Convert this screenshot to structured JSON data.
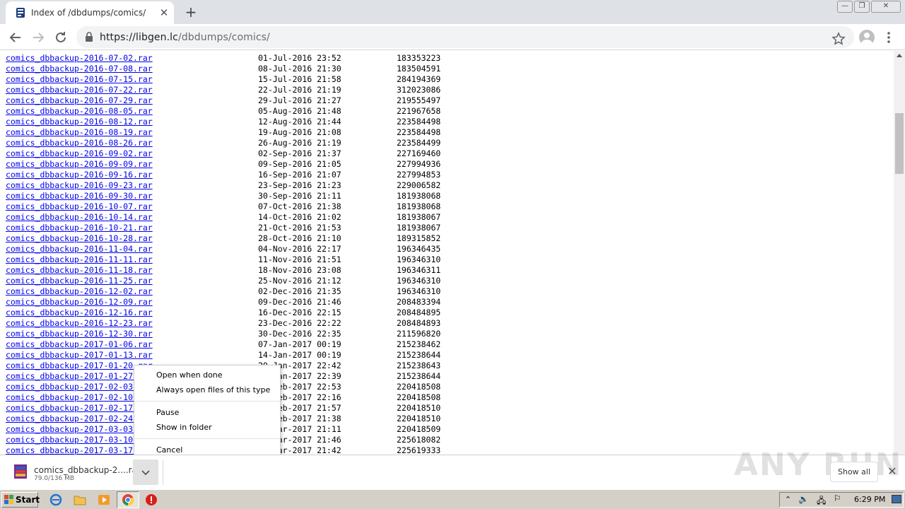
{
  "browser": {
    "tab_title": "Index of /dbdumps/comics/",
    "url_host": "https://libgen.lc",
    "url_path": "/dbdumps/comics/"
  },
  "listing": [
    {
      "name": "comics_dbbackup-2016-07-02.rar",
      "date": "01-Jul-2016 23:52",
      "size": "183353223"
    },
    {
      "name": "comics_dbbackup-2016-07-08.rar",
      "date": "08-Jul-2016 21:30",
      "size": "183504591"
    },
    {
      "name": "comics_dbbackup-2016-07-15.rar",
      "date": "15-Jul-2016 21:58",
      "size": "284194369"
    },
    {
      "name": "comics_dbbackup-2016-07-22.rar",
      "date": "22-Jul-2016 21:19",
      "size": "312023086"
    },
    {
      "name": "comics_dbbackup-2016-07-29.rar",
      "date": "29-Jul-2016 21:27",
      "size": "219555497"
    },
    {
      "name": "comics_dbbackup-2016-08-05.rar",
      "date": "05-Aug-2016 21:48",
      "size": "221967658"
    },
    {
      "name": "comics_dbbackup-2016-08-12.rar",
      "date": "12-Aug-2016 21:44",
      "size": "223584498"
    },
    {
      "name": "comics_dbbackup-2016-08-19.rar",
      "date": "19-Aug-2016 21:08",
      "size": "223584498"
    },
    {
      "name": "comics_dbbackup-2016-08-26.rar",
      "date": "26-Aug-2016 21:19",
      "size": "223584499"
    },
    {
      "name": "comics_dbbackup-2016-09-02.rar",
      "date": "02-Sep-2016 21:37",
      "size": "227169460"
    },
    {
      "name": "comics_dbbackup-2016-09-09.rar",
      "date": "09-Sep-2016 21:05",
      "size": "227994936"
    },
    {
      "name": "comics_dbbackup-2016-09-16.rar",
      "date": "16-Sep-2016 21:07",
      "size": "227994853"
    },
    {
      "name": "comics_dbbackup-2016-09-23.rar",
      "date": "23-Sep-2016 21:23",
      "size": "229006582"
    },
    {
      "name": "comics_dbbackup-2016-09-30.rar",
      "date": "30-Sep-2016 21:11",
      "size": "181938068"
    },
    {
      "name": "comics_dbbackup-2016-10-07.rar",
      "date": "07-Oct-2016 21:38",
      "size": "181938068"
    },
    {
      "name": "comics_dbbackup-2016-10-14.rar",
      "date": "14-Oct-2016 21:02",
      "size": "181938067"
    },
    {
      "name": "comics_dbbackup-2016-10-21.rar",
      "date": "21-Oct-2016 21:53",
      "size": "181938067"
    },
    {
      "name": "comics_dbbackup-2016-10-28.rar",
      "date": "28-Oct-2016 21:10",
      "size": "189315852"
    },
    {
      "name": "comics_dbbackup-2016-11-04.rar",
      "date": "04-Nov-2016 22:17",
      "size": "196346435"
    },
    {
      "name": "comics_dbbackup-2016-11-11.rar",
      "date": "11-Nov-2016 21:51",
      "size": "196346310"
    },
    {
      "name": "comics_dbbackup-2016-11-18.rar",
      "date": "18-Nov-2016 23:08",
      "size": "196346311"
    },
    {
      "name": "comics_dbbackup-2016-11-25.rar",
      "date": "25-Nov-2016 21:12",
      "size": "196346310"
    },
    {
      "name": "comics_dbbackup-2016-12-02.rar",
      "date": "02-Dec-2016 21:35",
      "size": "196346310"
    },
    {
      "name": "comics_dbbackup-2016-12-09.rar",
      "date": "09-Dec-2016 21:46",
      "size": "208483394"
    },
    {
      "name": "comics_dbbackup-2016-12-16.rar",
      "date": "16-Dec-2016 22:15",
      "size": "208484895"
    },
    {
      "name": "comics_dbbackup-2016-12-23.rar",
      "date": "23-Dec-2016 22:22",
      "size": "208484893"
    },
    {
      "name": "comics_dbbackup-2016-12-30.rar",
      "date": "30-Dec-2016 22:35",
      "size": "211596820"
    },
    {
      "name": "comics_dbbackup-2017-01-06.rar",
      "date": "07-Jan-2017 00:19",
      "size": "215238462"
    },
    {
      "name": "comics_dbbackup-2017-01-13.rar",
      "date": "14-Jan-2017 00:19",
      "size": "215238644"
    },
    {
      "name": "comics_dbbackup-2017-01-20.rar",
      "date": "20-Jan-2017 22:42",
      "size": "215238643"
    },
    {
      "name": "comics_dbbackup-2017-01-27.rar",
      "date": "27-Jan-2017 22:39",
      "size": "215238644"
    },
    {
      "name": "comics_dbbackup-2017-02-03.rar",
      "date": "03-Feb-2017 22:53",
      "size": "220418508"
    },
    {
      "name": "comics_dbbackup-2017-02-10.rar",
      "date": "10-Feb-2017 22:16",
      "size": "220418508"
    },
    {
      "name": "comics_dbbackup-2017-02-17.rar",
      "date": "17-Feb-2017 21:57",
      "size": "220418510"
    },
    {
      "name": "comics_dbbackup-2017-02-24.rar",
      "date": "24-Feb-2017 21:38",
      "size": "220418510"
    },
    {
      "name": "comics_dbbackup-2017-03-03.rar",
      "date": "03-Mar-2017 21:11",
      "size": "220418509"
    },
    {
      "name": "comics_dbbackup-2017-03-10.rar",
      "date": "10-Mar-2017 21:46",
      "size": "225618082"
    },
    {
      "name": "comics_dbbackup-2017-03-17.rar",
      "date": "17-Mar-2017 21:42",
      "size": "225619333"
    }
  ],
  "context_menu": {
    "open_when_done": "Open when done",
    "always_open": "Always open files of this type",
    "pause": "Pause",
    "show_in_folder": "Show in folder",
    "cancel": "Cancel"
  },
  "download_shelf": {
    "file_name": "comics_dbbackup-2....rar",
    "progress_text": "79.0/136 MB",
    "show_all": "Show all",
    "watermark": "ANY RUN"
  },
  "taskbar": {
    "start_label": "Start",
    "clock": "6:29 PM"
  }
}
